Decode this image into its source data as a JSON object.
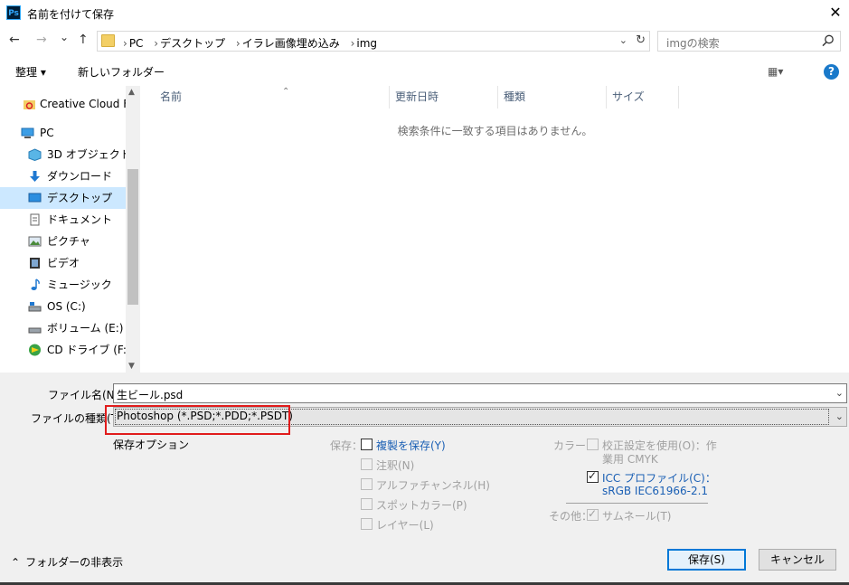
{
  "titlebar": {
    "app_icon": "Ps",
    "title": "名前を付けて保存",
    "close_icon": "close-icon"
  },
  "address": {
    "back_icon": "←",
    "forward_icon": "→",
    "recent_icon": "⌄",
    "up_icon": "↑",
    "crumbs": [
      "PC",
      "デスクトップ",
      "イラレ画像埋め込み",
      "img"
    ],
    "search_placeholder": "imgの検索"
  },
  "toolbar": {
    "organize": "整理 ▾",
    "new_folder": "新しいフォルダー",
    "view_icon": "▦▾",
    "help": "?"
  },
  "nav": {
    "items": [
      {
        "label": "Creative Cloud Files",
        "icon": "creative-cloud-icon"
      },
      {
        "label": "PC",
        "icon": "pc-icon"
      },
      {
        "label": "3D オブジェクト",
        "icon": "3d-objects-icon"
      },
      {
        "label": "ダウンロード",
        "icon": "download-icon"
      },
      {
        "label": "デスクトップ",
        "icon": "desktop-icon",
        "selected": true
      },
      {
        "label": "ドキュメント",
        "icon": "documents-icon"
      },
      {
        "label": "ピクチャ",
        "icon": "pictures-icon"
      },
      {
        "label": "ビデオ",
        "icon": "videos-icon"
      },
      {
        "label": "ミュージック",
        "icon": "music-icon"
      },
      {
        "label": "OS (C:)",
        "icon": "drive-c-icon"
      },
      {
        "label": "ボリューム (E:)",
        "icon": "drive-e-icon"
      },
      {
        "label": "CD ドライブ (F:) M",
        "icon": "cd-drive-icon"
      }
    ]
  },
  "list": {
    "columns": [
      "名前",
      "更新日時",
      "種類",
      "サイズ"
    ],
    "empty_message": "検索条件に一致する項目はありません。"
  },
  "form": {
    "filename_label": "ファイル名(N):",
    "filename_value": "生ビール.psd",
    "filetype_label": "ファイルの種類(T):",
    "filetype_value": "Photoshop (*.PSD;*.PDD;*.PSDT)",
    "save_options_label": "保存オプション",
    "save_label": "保存：",
    "color_label": "カラー：",
    "other_label": "その他：",
    "save_opts": [
      {
        "label": "複製を保存(Y)",
        "checked": false,
        "enabled": true
      },
      {
        "label": "注釈(N)",
        "checked": false,
        "enabled": false
      },
      {
        "label": "アルファチャンネル(H)",
        "checked": false,
        "enabled": false
      },
      {
        "label": "スポットカラー(P)",
        "checked": false,
        "enabled": false
      },
      {
        "label": "レイヤー(L)",
        "checked": false,
        "enabled": false
      }
    ],
    "proof_line1": "校正設定を使用(O)：作",
    "proof_line2": "業用 CMYK",
    "icc_line1": "ICC プロファイル(C)：",
    "icc_line2": "sRGB IEC61966-2.1",
    "thumbnail": "サムネール(T)"
  },
  "footer": {
    "hide_folders": "フォルダーの非表示",
    "save_button": "保存(S)",
    "cancel_button": "キャンセル"
  },
  "colors": {
    "accent": "#0078d7",
    "highlight": "#e11c1c",
    "selection": "#cce8ff",
    "link": "#1a5fb4"
  }
}
